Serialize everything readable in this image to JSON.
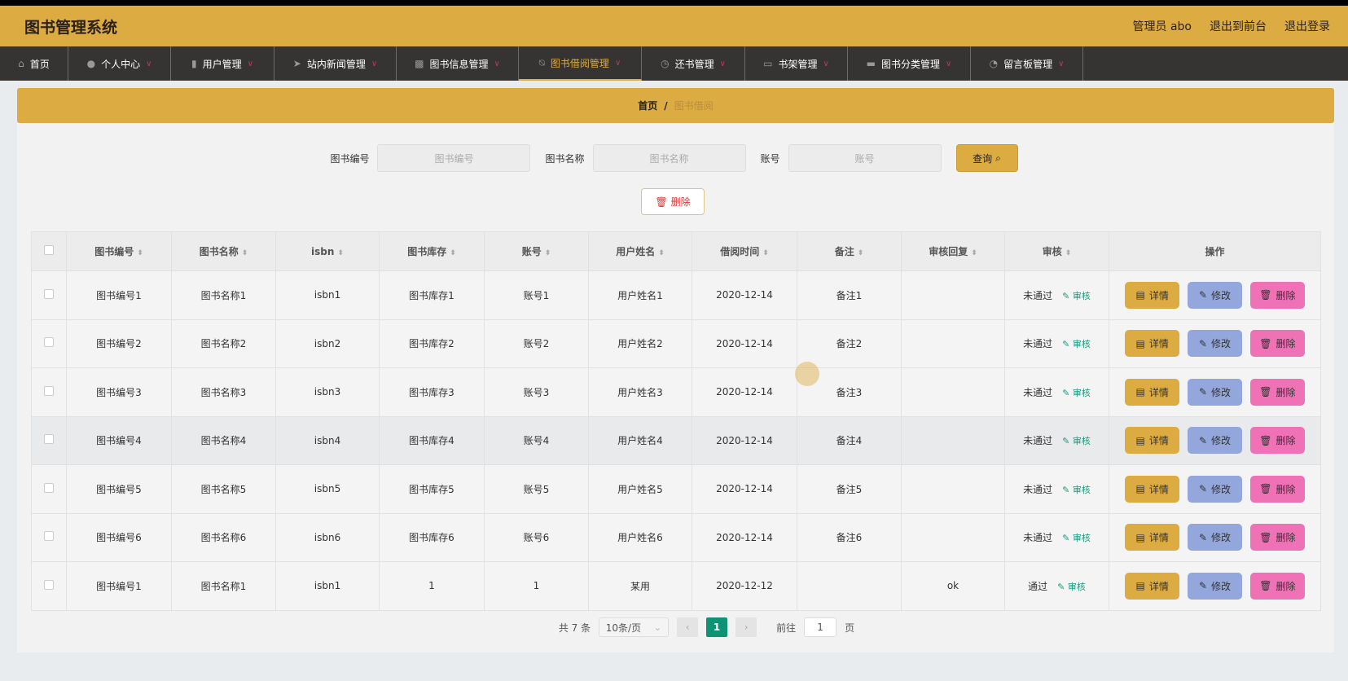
{
  "header": {
    "title": "图书管理系统",
    "user": "管理员 abo",
    "to_front": "退出到前台",
    "logout": "退出登录"
  },
  "nav": [
    {
      "label": "首页",
      "icon": "⌂",
      "chev": false
    },
    {
      "label": "个人中心",
      "icon": "●",
      "chev": true
    },
    {
      "label": "用户管理",
      "icon": "▮",
      "chev": true
    },
    {
      "label": "站内新闻管理",
      "icon": "➤",
      "chev": true
    },
    {
      "label": "图书信息管理",
      "icon": "▩",
      "chev": true
    },
    {
      "label": "图书借阅管理",
      "icon": "⍉",
      "chev": true,
      "active": true
    },
    {
      "label": "还书管理",
      "icon": "◷",
      "chev": true
    },
    {
      "label": "书架管理",
      "icon": "▭",
      "chev": true
    },
    {
      "label": "图书分类管理",
      "icon": "▬",
      "chev": true
    },
    {
      "label": "留言板管理",
      "icon": "◔",
      "chev": true
    }
  ],
  "breadcrumb": {
    "home": "首页",
    "sep": "/",
    "current": "图书借阅"
  },
  "search": {
    "f1_label": "图书编号",
    "f1_ph": "图书编号",
    "f2_label": "图书名称",
    "f2_ph": "图书名称",
    "f3_label": "账号",
    "f3_ph": "账号",
    "query": "查询"
  },
  "delete_label": "删除",
  "columns": [
    "图书编号",
    "图书名称",
    "isbn",
    "图书库存",
    "账号",
    "用户姓名",
    "借阅时间",
    "备注",
    "审核回复",
    "审核",
    "操作"
  ],
  "rows": [
    [
      "图书编号1",
      "图书名称1",
      "isbn1",
      "图书库存1",
      "账号1",
      "用户姓名1",
      "2020-12-14",
      "备注1",
      "",
      "未通过"
    ],
    [
      "图书编号2",
      "图书名称2",
      "isbn2",
      "图书库存2",
      "账号2",
      "用户姓名2",
      "2020-12-14",
      "备注2",
      "",
      "未通过"
    ],
    [
      "图书编号3",
      "图书名称3",
      "isbn3",
      "图书库存3",
      "账号3",
      "用户姓名3",
      "2020-12-14",
      "备注3",
      "",
      "未通过"
    ],
    [
      "图书编号4",
      "图书名称4",
      "isbn4",
      "图书库存4",
      "账号4",
      "用户姓名4",
      "2020-12-14",
      "备注4",
      "",
      "未通过"
    ],
    [
      "图书编号5",
      "图书名称5",
      "isbn5",
      "图书库存5",
      "账号5",
      "用户姓名5",
      "2020-12-14",
      "备注5",
      "",
      "未通过"
    ],
    [
      "图书编号6",
      "图书名称6",
      "isbn6",
      "图书库存6",
      "账号6",
      "用户姓名6",
      "2020-12-14",
      "备注6",
      "",
      "未通过"
    ],
    [
      "图书编号1",
      "图书名称1",
      "isbn1",
      "1",
      "1",
      "某用",
      "2020-12-12",
      "",
      "ok",
      "通过"
    ]
  ],
  "row_actions": {
    "audit": "审核",
    "detail": "详情",
    "edit": "修改",
    "delete": "删除"
  },
  "pager": {
    "total": "共 7 条",
    "size": "10条/页",
    "page": "1",
    "goto": "前往",
    "goto_value": "1",
    "unit": "页"
  }
}
